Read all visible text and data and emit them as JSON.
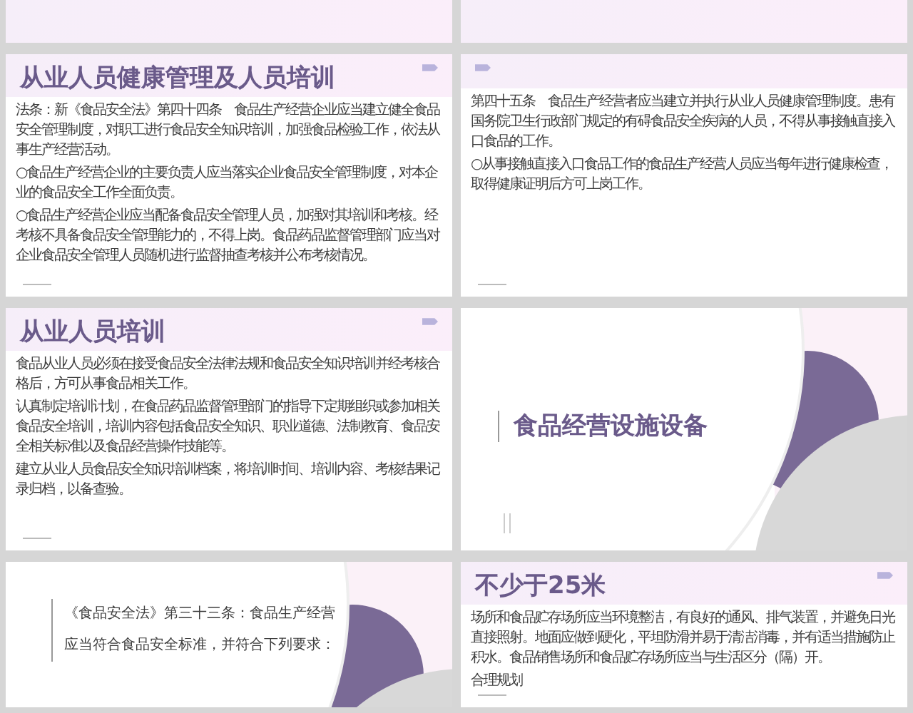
{
  "slides": [
    {
      "kind": "blank"
    },
    {
      "kind": "blank"
    },
    {
      "kind": "text",
      "title": "从业人员健康管理及人员培训",
      "paragraphs": [
        "法条：新《食品安全法》第四十四条　食品生产经营企业应当建立健全食品安全管理制度，对职工进行食品安全知识培训，加强食品检验工作，依法从事生产经营活动。",
        "○食品生产经营企业的主要负责人应当落实企业食品安全管理制度，对本企业的食品安全工作全面负责。",
        "○食品生产经营企业应当配备食品安全管理人员，加强对其培训和考核。经考核不具备食品安全管理能力的，不得上岗。食品药品监督管理部门应当对企业食品安全管理人员随机进行监督抽查考核并公布考核情况。"
      ]
    },
    {
      "kind": "text",
      "paragraphs": [
        "第四十五条　食品生产经营者应当建立并执行从业人员健康管理制度。患有国务院卫生行政部门规定的有碍食品安全疾病的人员，不得从事接触直接入口食品的工作。",
        "○从事接触直接入口食品工作的食品生产经营人员应当每年进行健康检查，取得健康证明后方可上岗工作。"
      ]
    },
    {
      "kind": "text",
      "title": "从业人员培训",
      "paragraphs": [
        "食品从业人员必须在接受食品安全法律法规和食品安全知识培训并经考核合格后，方可从事食品相关工作。",
        "认真制定培训计划，在食品药品监督管理部门的指导下定期组织或参加相关食品安全培训，培训内容包括食品安全知识、职业道德、法制教育、食品安全相关标准以及食品经营操作技能等。",
        "建立从业人员食品安全知识培训档案，将培训时间、培训内容、考核结果记录归档，以备查验。"
      ]
    },
    {
      "kind": "section",
      "title": "食品经营设施设备"
    },
    {
      "kind": "quote",
      "paragraphs": [
        "《食品安全法》第三十三条：食品生产经营应当符合食品安全标准，并符合下列要求："
      ]
    },
    {
      "kind": "text",
      "title": "不少于25米",
      "paragraphs": [
        "场所和食品贮存场所应当环境整洁，有良好的通风、排气装置，并避免日光直接照射。地面应做到硬化，平坦防滑并易于清洁消毒，并有适当措施防止积水。食品销售场所和食品贮存场所应当与生活区分（隔）开。",
        "合理规划"
      ]
    }
  ]
}
